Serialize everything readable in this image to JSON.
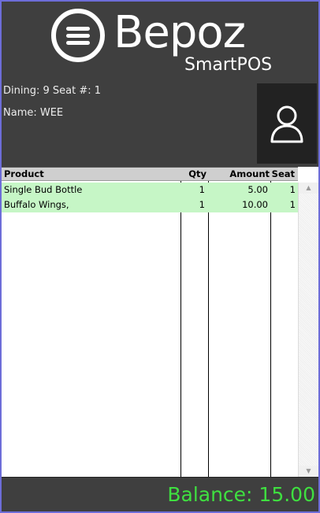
{
  "header": {
    "brand": "Bepoz",
    "brand_sub": "SmartPOS",
    "dining_line": "Dining: 9  Seat #: 1",
    "name_line": "Name: WEE",
    "avatar_icon": "user-icon"
  },
  "grid": {
    "columns": {
      "product": "Product",
      "qty": "Qty",
      "amount": "Amount",
      "seat": "Seat"
    },
    "rows": [
      {
        "product": "Single Bud Bottle",
        "qty": "1",
        "amount": "5.00",
        "seat": "1"
      },
      {
        "product": "Buffalo Wings,",
        "qty": "1",
        "amount": "10.00",
        "seat": "1"
      }
    ],
    "row_color": "#c6f6c6"
  },
  "footer": {
    "balance_text": "Balance: 15.00",
    "balance_color": "#3fe040"
  },
  "colors": {
    "header_bg": "#3f3f3f",
    "frame_border": "#6d6dd8"
  }
}
